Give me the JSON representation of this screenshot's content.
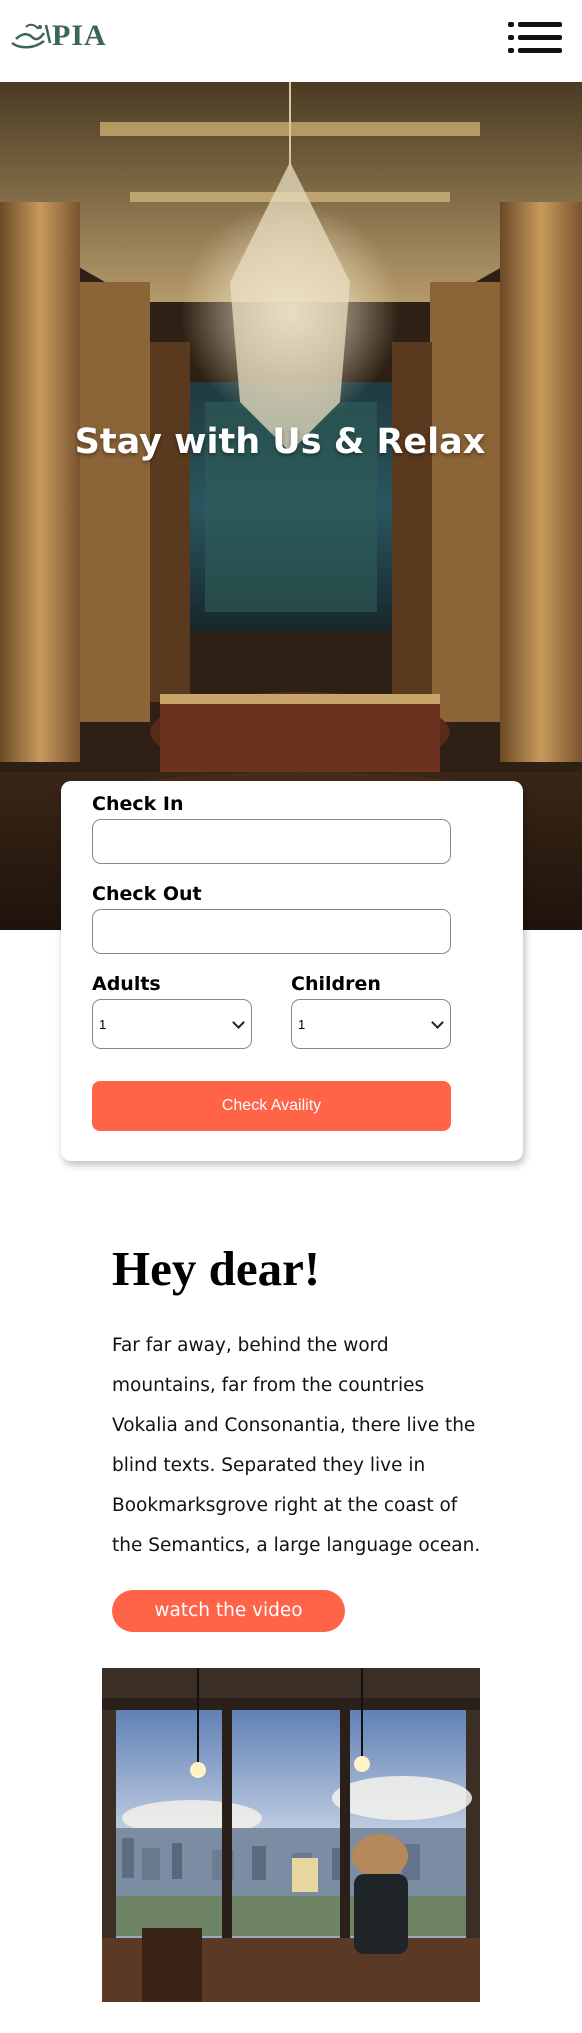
{
  "header": {
    "logo_text": "PIA"
  },
  "hero": {
    "title": "Stay with Us & Relax"
  },
  "booking": {
    "check_in_label": "Check In",
    "check_in_value": "",
    "check_out_label": "Check Out",
    "check_out_value": "",
    "adults_label": "Adults",
    "adults_value": "1",
    "children_label": "Children",
    "children_value": "1",
    "submit_label": "Check Availity"
  },
  "intro": {
    "heading": "Hey dear!",
    "body": "Far far away, behind the word mountains, far from the countries Vokalia and Consonantia, there live the blind texts. Separated they live in Bookmarksgrove right at the coast of the Semantics, a large language ocean.",
    "video_button": "watch the video"
  },
  "colors": {
    "accent": "#ff6348",
    "logo": "#3c6654"
  }
}
